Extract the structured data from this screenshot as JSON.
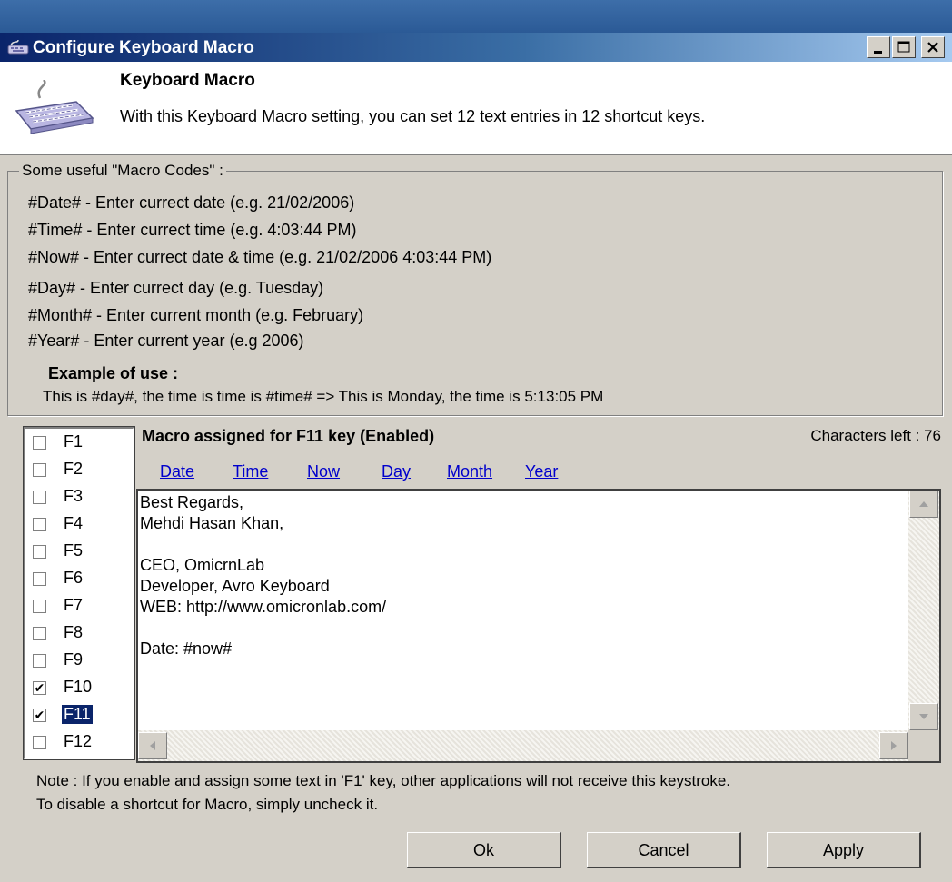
{
  "window": {
    "title": "Configure Keyboard Macro",
    "controls": {
      "minimize": "_",
      "maximize": "□",
      "close": "✕"
    }
  },
  "header": {
    "title": "Keyboard Macro",
    "description": "With this Keyboard Macro setting, you can set 12 text entries in 12 shortcut keys.",
    "icon": "keyboard-icon"
  },
  "macro_codes": {
    "legend": "Some useful \"Macro Codes\" :",
    "items": [
      "#Date# - Enter currect date (e.g. 21/02/2006)",
      "#Time# - Enter currect time (e.g. 4:03:44 PM)",
      "#Now# - Enter currect date & time (e.g. 21/02/2006 4:03:44 PM)",
      "#Day# - Enter currect day (e.g. Tuesday)",
      "#Month# - Enter current month (e.g. February)",
      "#Year# - Enter current year (e.g 2006)"
    ],
    "example_title": "Example of use :",
    "example_text": "This is #day#, the time is time is #time# => This is Monday, the time is 5:13:05 PM"
  },
  "fkeys": [
    {
      "label": "F1",
      "checked": false
    },
    {
      "label": "F2",
      "checked": false
    },
    {
      "label": "F3",
      "checked": false
    },
    {
      "label": "F4",
      "checked": false
    },
    {
      "label": "F5",
      "checked": false
    },
    {
      "label": "F6",
      "checked": false
    },
    {
      "label": "F7",
      "checked": false
    },
    {
      "label": "F8",
      "checked": false
    },
    {
      "label": "F9",
      "checked": false
    },
    {
      "label": "F10",
      "checked": true
    },
    {
      "label": "F11",
      "checked": true,
      "selected": true
    },
    {
      "label": "F12",
      "checked": false
    }
  ],
  "macro": {
    "title": "Macro assigned for  F11 key (Enabled)",
    "chars_left": "Characters left : 76",
    "insert_links": [
      "Date",
      "Time",
      "Now",
      "Day",
      "Month",
      "Year"
    ],
    "text": "Best Regards,\nMehdi Hasan Khan,\n\nCEO, OmicrnLab\nDeveloper, Avro Keyboard\nWEB: http://www.omicronlab.com/\n\nDate: #now#"
  },
  "note": {
    "line1": "Note : If you enable and assign some text in 'F1' key, other applications will not receive this keystroke.",
    "line2": "To disable a shortcut for Macro, simply uncheck it."
  },
  "buttons": {
    "ok": "Ok",
    "cancel": "Cancel",
    "apply": "Apply"
  },
  "colors": {
    "title_start": "#0a246a",
    "title_end": "#a6caf0",
    "link": "#0000cc",
    "selection": "#0a246a",
    "face": "#d4d0c8"
  }
}
